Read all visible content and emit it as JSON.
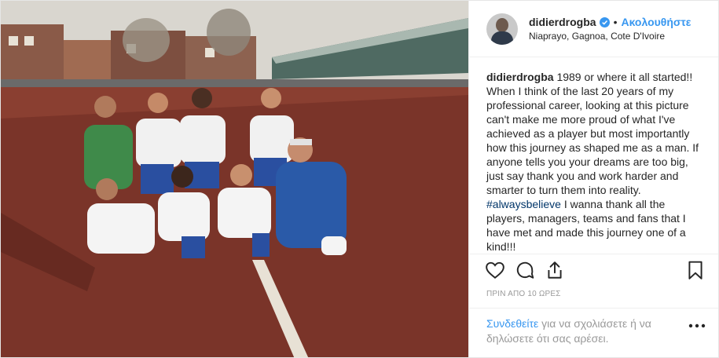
{
  "header": {
    "username": "didierdrogba",
    "separator": "•",
    "follow_label": "Ακολουθήστε",
    "location": "Niaprayo, Gagnoa, Cote D'Ivoire"
  },
  "caption": {
    "username": "didierdrogba",
    "text": "1989 or where it all started!! When I think of the last 20 years of my professional career, looking at this picture can't make me more proud of what I've achieved as a player but most importantly how this journey as shaped me as a man. If anyone tells you your dreams are too big, just say thank you and work harder and smarter to turn them into reality.",
    "hashtag": "#alwaysbelieve",
    "text2": "I wanna thank all the players, managers, teams and fans that I have met and made this journey one of a kind!!!"
  },
  "timestamp": "ΠΡΙΝ ΑΠΟ 10 ΩΡΕΣ",
  "login_prompt": {
    "link": "Συνδεθείτε",
    "text": " για να σχολιάσετε ή να δηλώσετε ότι σας αρέσει."
  },
  "colors": {
    "accent": "#3897f0",
    "hashtag": "#003569",
    "muted": "#999999"
  },
  "icons": [
    "verified-badge-icon",
    "heart-icon",
    "comment-icon",
    "share-icon",
    "bookmark-icon",
    "more-options-icon"
  ]
}
